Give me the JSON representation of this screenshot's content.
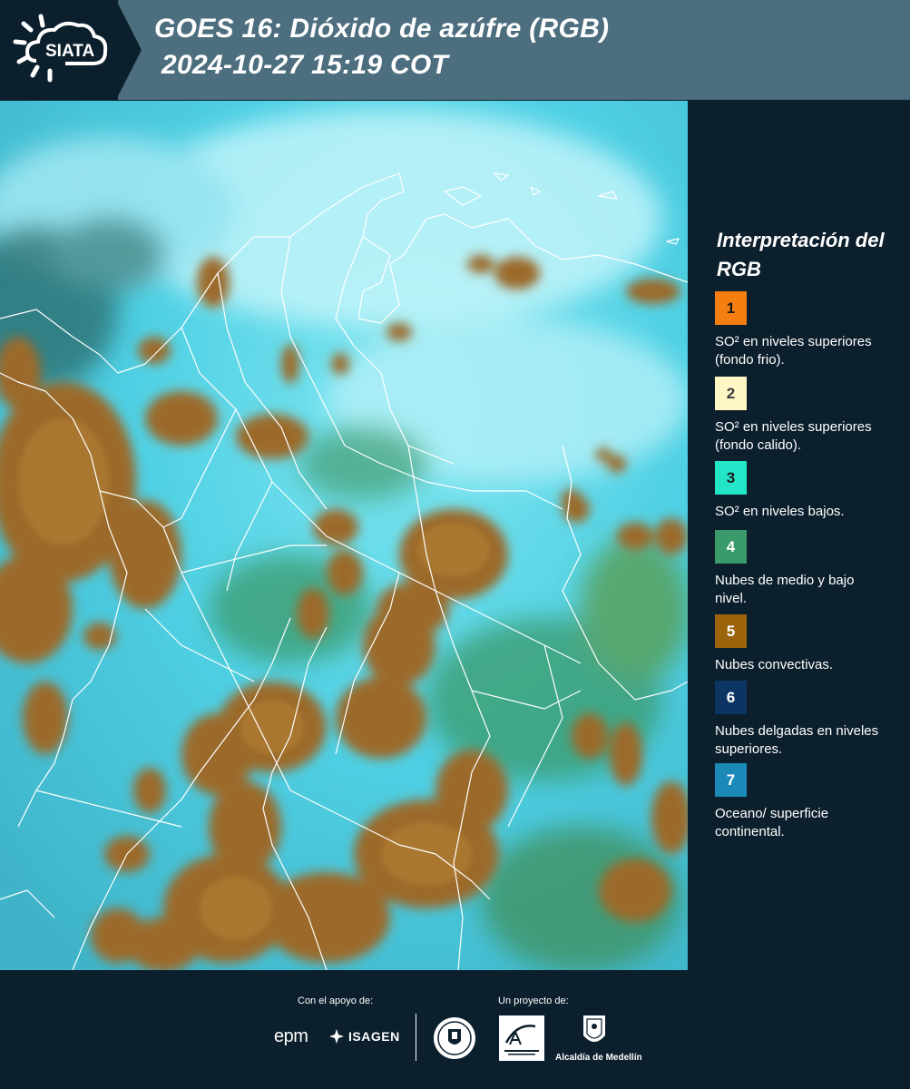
{
  "header": {
    "logo_text": "SIATA",
    "title_line1": "GOES 16: Dióxido de azúfre (RGB)",
    "title_line2": "2024-10-27 15:19 COT"
  },
  "legend": {
    "title": "Interpretación del RGB",
    "items": [
      {
        "number": "1",
        "color": "#f57e10",
        "number_color": "#1a1a1a",
        "text": "SO² en niveles superiores (fondo frio)."
      },
      {
        "number": "2",
        "color": "#fff6c6",
        "number_color": "#3a3a3a",
        "text": "SO² en niveles superiores (fondo calido)."
      },
      {
        "number": "3",
        "color": "#23e6c8",
        "number_color": "#1a1a1a",
        "text": "SO² en niveles bajos."
      },
      {
        "number": "4",
        "color": "#3b9a6a",
        "number_color": "#ffffff",
        "text": "Nubes de medio y bajo nivel."
      },
      {
        "number": "5",
        "color": "#9b640a",
        "number_color": "#ffffff",
        "text": "Nubes convectivas."
      },
      {
        "number": "6",
        "color": "#0d3563",
        "number_color": "#ffffff",
        "text": "Nubes delgadas en niveles superiores."
      },
      {
        "number": "7",
        "color": "#1c8ab8",
        "number_color": "#ffffff",
        "text": "Oceano/ superficie continental."
      }
    ]
  },
  "footer": {
    "support_label": "Con el apoyo de:",
    "project_label": "Un proyecto de:",
    "epm": "epm",
    "isagen": "ISAGEN",
    "alcaldia": "Alcaldía de Medellín"
  },
  "colors": {
    "header_bg": "#4d6e7e",
    "panel_bg": "#0c1f2c",
    "sky_cyan": "#5ed6ea",
    "convective_brown": "#9b6a2a",
    "border_white": "#ffffff"
  }
}
